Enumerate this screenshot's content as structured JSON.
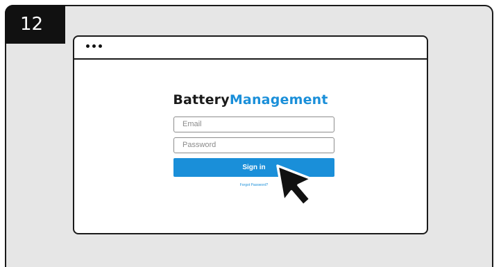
{
  "step": {
    "number": "12"
  },
  "browser": {
    "dots_icon": "more-dots-icon"
  },
  "app": {
    "logo_part_a": "Battery",
    "logo_part_b": "Management",
    "brand_color": "#1a8fd9"
  },
  "login_form": {
    "email_placeholder": "Email",
    "password_placeholder": "Password",
    "signin_label": "Sign in",
    "forgot_password_label": "Forgot Password?"
  },
  "cursor": {
    "icon": "mouse-pointer-icon"
  }
}
